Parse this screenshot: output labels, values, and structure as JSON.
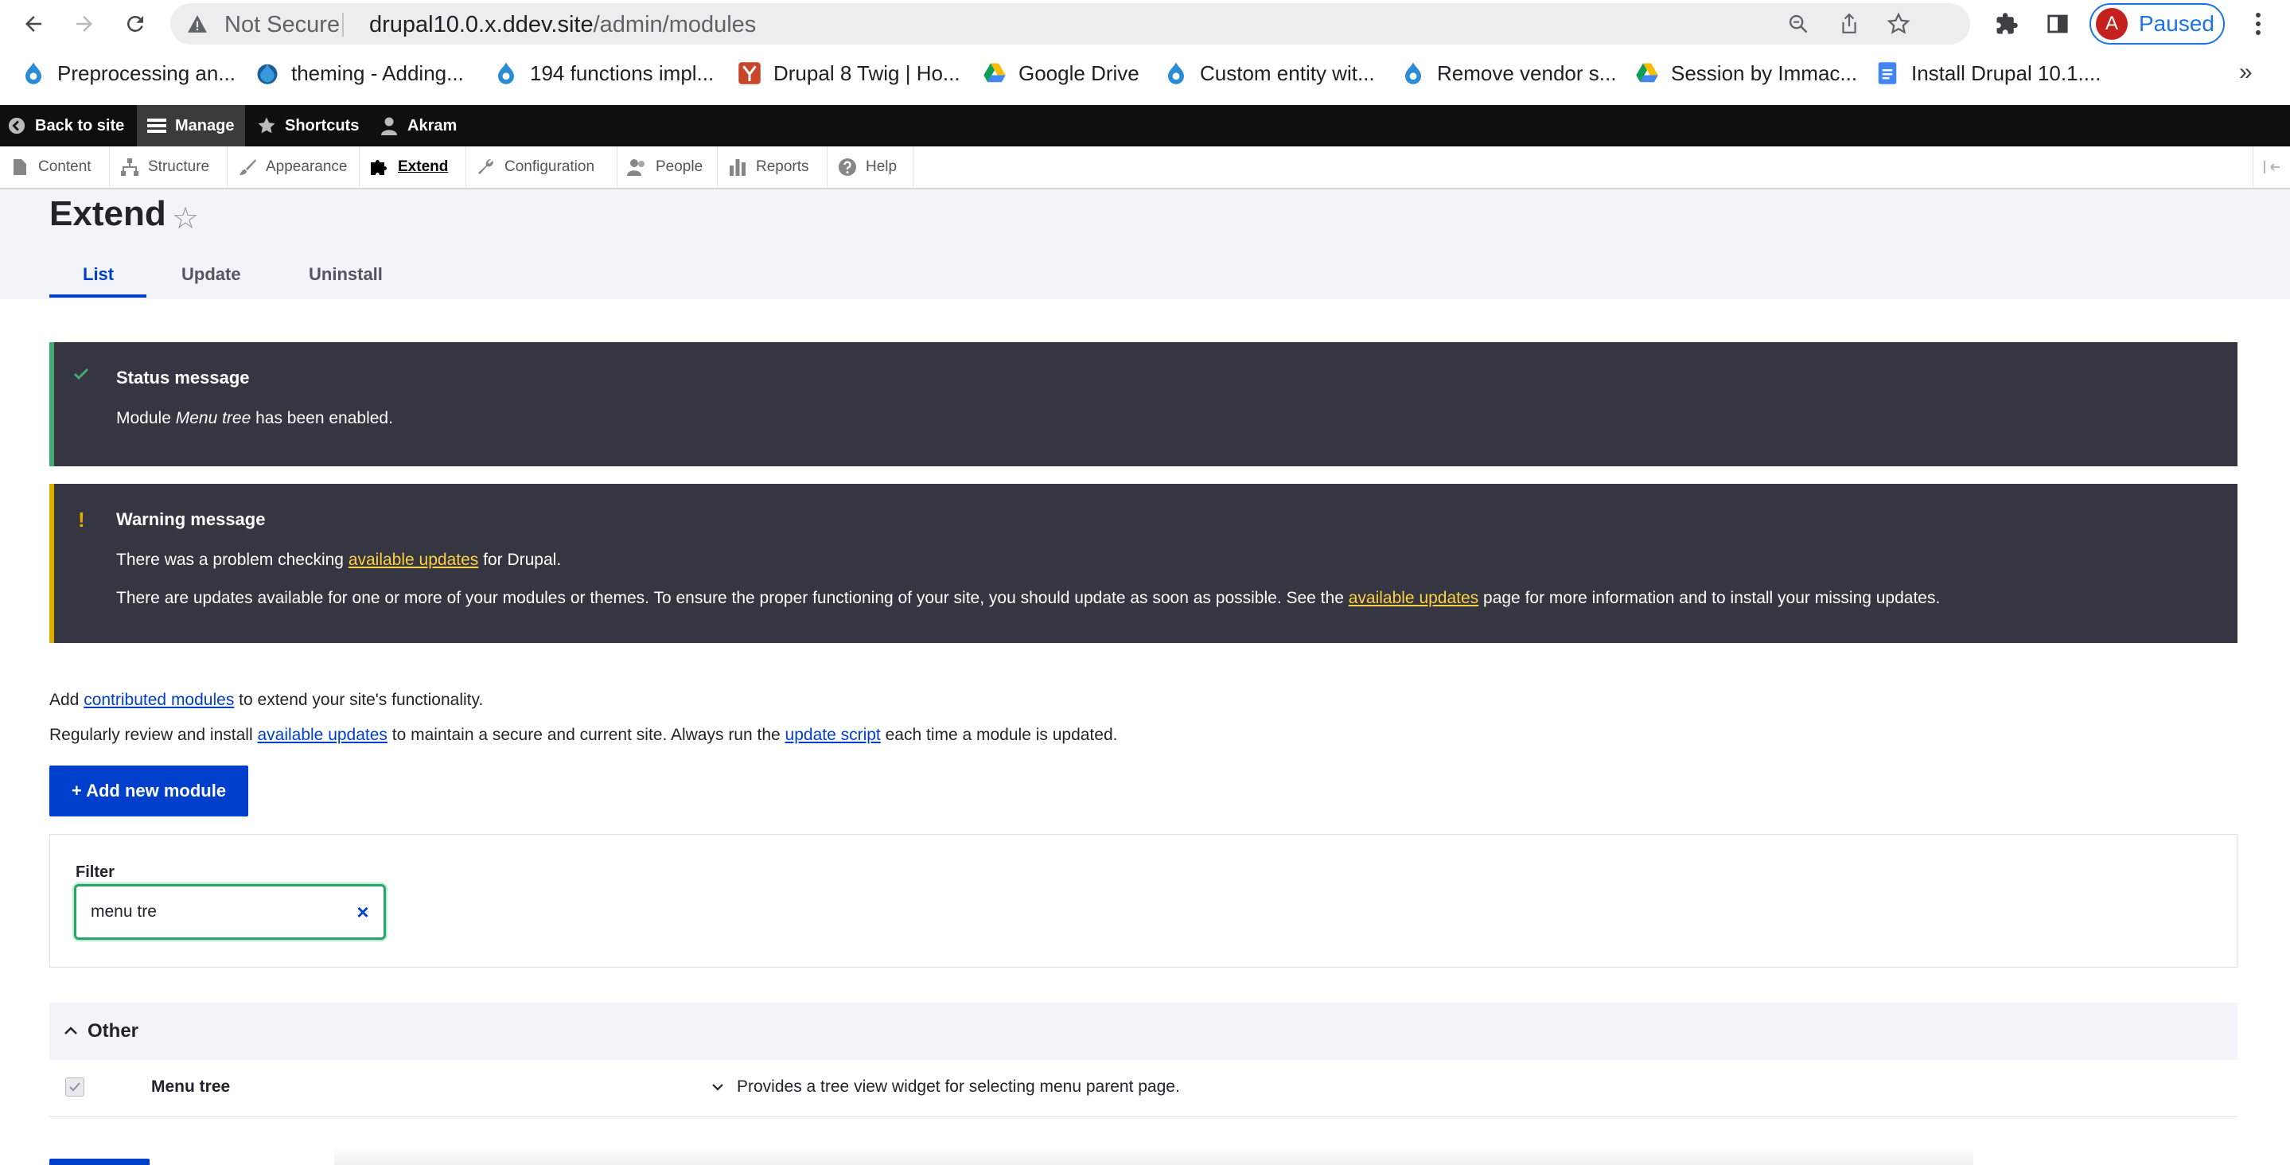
{
  "browser": {
    "security_label": "Not Secure",
    "url_host": "drupal10.0.x.ddev.site",
    "url_path": "/admin/modules",
    "profile_initial": "A",
    "profile_status": "Paused",
    "bookmarks": [
      {
        "label": "Preprocessing an...",
        "icon": "drupal-icon"
      },
      {
        "label": "theming - Adding...",
        "icon": "drupal-drop-icon"
      },
      {
        "label": "194 functions impl...",
        "icon": "drupal-icon"
      },
      {
        "label": "Drupal 8 Twig | Ho...",
        "icon": "ydrupal-icon"
      },
      {
        "label": "Google Drive",
        "icon": "google-drive-icon"
      },
      {
        "label": "Custom entity wit...",
        "icon": "drupal-icon"
      },
      {
        "label": "Remove vendor s...",
        "icon": "drupal-icon"
      },
      {
        "label": "Session by Immac...",
        "icon": "google-drive-icon"
      },
      {
        "label": "Install Drupal 10.1....",
        "icon": "google-docs-icon"
      }
    ]
  },
  "toolbar": {
    "back_to_site": "Back to site",
    "manage": "Manage",
    "shortcuts": "Shortcuts",
    "user": "Akram",
    "tray": [
      "Content",
      "Structure",
      "Appearance",
      "Extend",
      "Configuration",
      "People",
      "Reports",
      "Help"
    ]
  },
  "page": {
    "title": "Extend",
    "tabs": [
      "List",
      "Update",
      "Uninstall"
    ],
    "active_tab": "List"
  },
  "messages": {
    "status": {
      "title": "Status message",
      "text_before": "Module ",
      "text_em": "Menu tree",
      "text_after": " has been enabled."
    },
    "warning": {
      "title": "Warning message",
      "line1_before": "There was a problem checking ",
      "line1_link": "available updates",
      "line1_after": " for Drupal.",
      "line2_before": "There are updates available for one or more of your modules or themes. To ensure the proper functioning of your site, you should update as soon as possible. See the ",
      "line2_link": "available updates",
      "line2_after": " page for more information and to install your missing updates."
    },
    "colors": {
      "status_accent": "#42a877",
      "warning_accent": "#e0ac00",
      "background": "#353641"
    }
  },
  "intro": {
    "line1_before": "Add ",
    "line1_link": "contributed modules",
    "line1_after": " to extend your site's functionality.",
    "line2_before": "Regularly review and install ",
    "line2_link1": "available updates",
    "line2_mid": " to maintain a secure and current site. Always run the ",
    "line2_link2": "update script",
    "line2_after": " each time a module is updated."
  },
  "actions": {
    "add_new_module": "+ Add new module"
  },
  "filter": {
    "label": "Filter",
    "value": "menu tre"
  },
  "package": {
    "name": "Other",
    "modules": [
      {
        "name": "Menu tree",
        "enabled": true,
        "description": "Provides a tree view widget for selecting menu parent page."
      }
    ]
  }
}
